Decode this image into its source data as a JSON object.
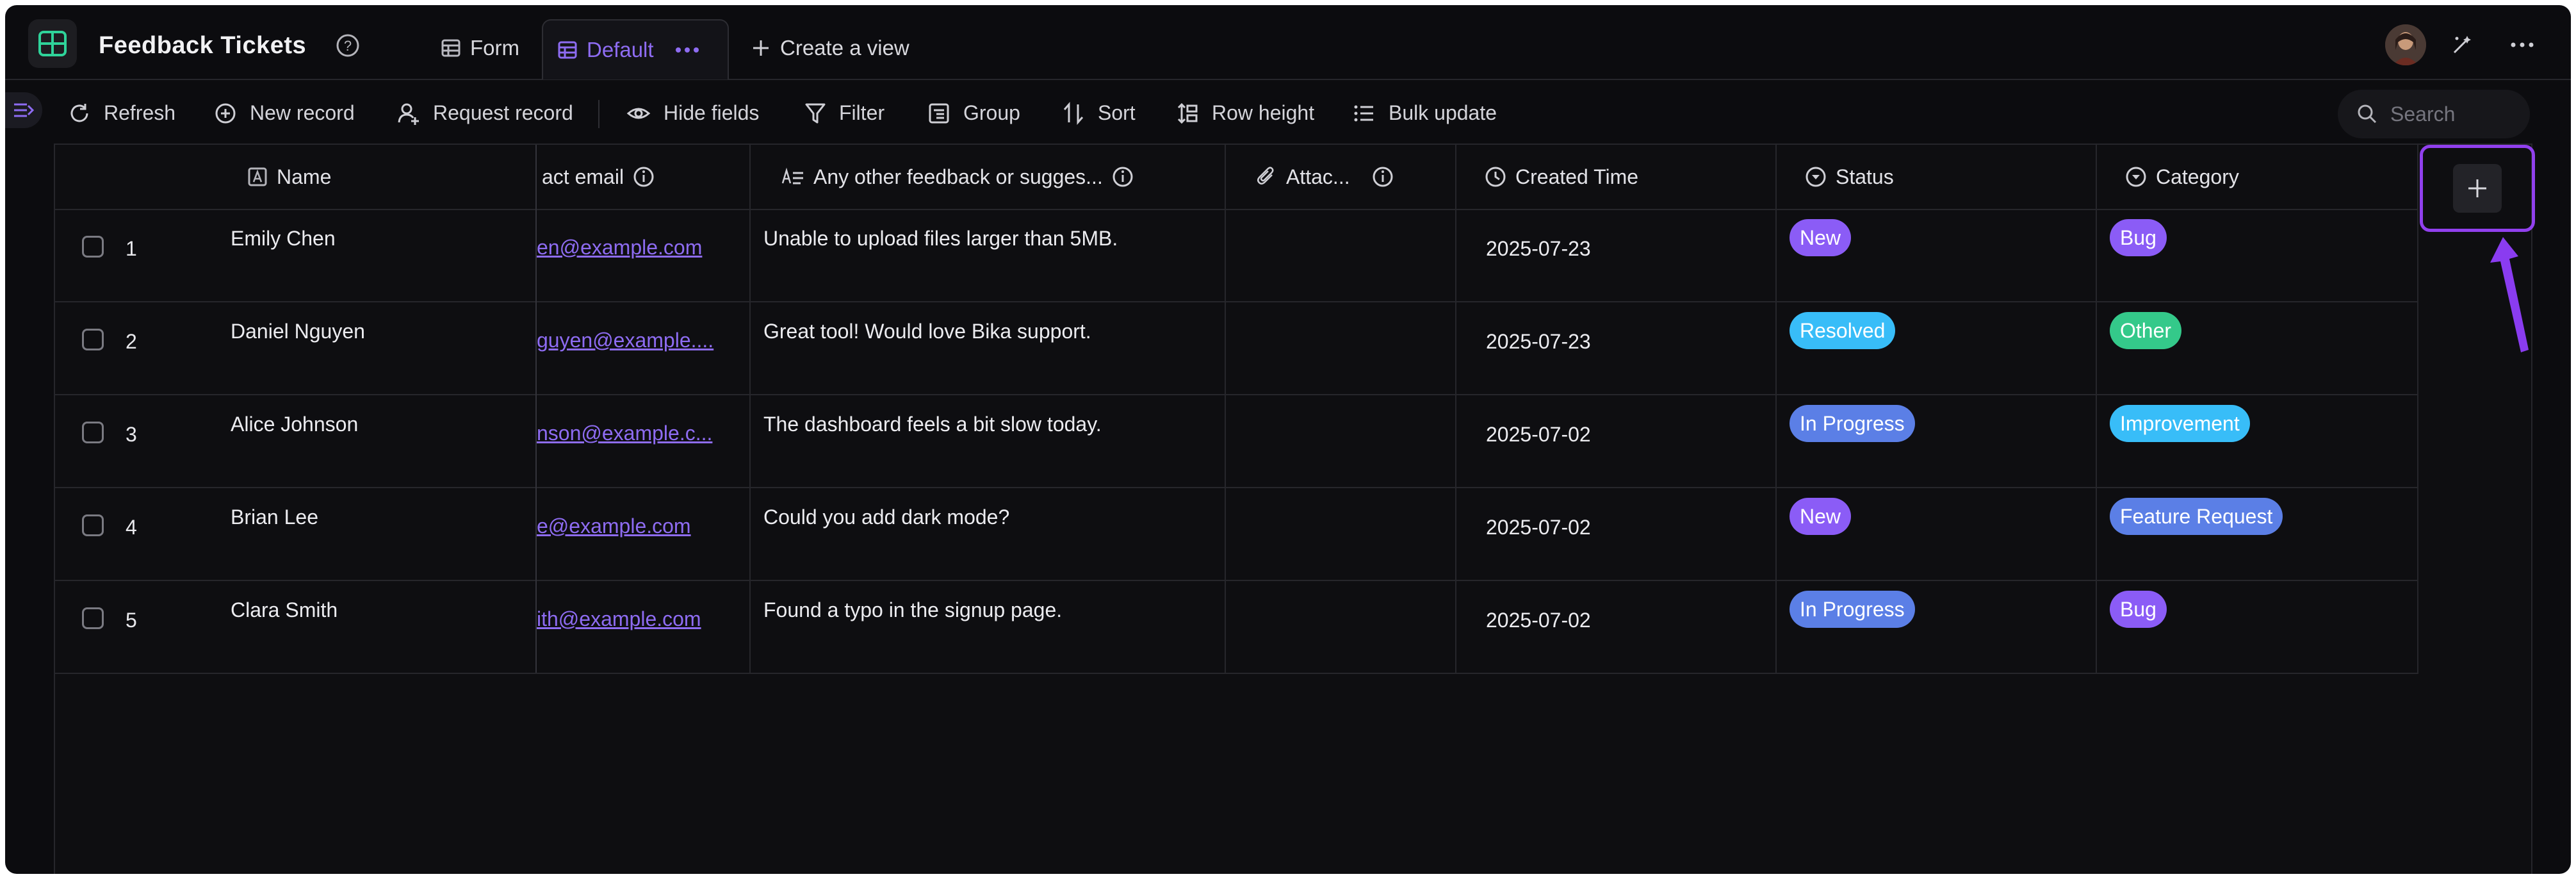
{
  "header": {
    "title": "Feedback Tickets",
    "tabs": [
      {
        "label": "Form",
        "icon": "table-icon"
      },
      {
        "label": "Default",
        "icon": "grid-view-icon",
        "active": true
      },
      {
        "label": "Create a view",
        "icon": "plus-icon"
      }
    ]
  },
  "toolbar": {
    "refresh": "Refresh",
    "new_record": "New record",
    "request_record": "Request record",
    "hide_fields": "Hide fields",
    "filter": "Filter",
    "group": "Group",
    "sort": "Sort",
    "row_height": "Row height",
    "bulk_update": "Bulk update",
    "search_placeholder": "Search"
  },
  "columns": {
    "name": "Name",
    "email": "act email",
    "feedback": "Any other feedback or sugges...",
    "attachment": "Attac...",
    "created": "Created Time",
    "status": "Status",
    "category": "Category"
  },
  "rows": [
    {
      "num": "1",
      "name": "Emily Chen",
      "email": "en@example.com",
      "feedback": "Unable to upload files larger than 5MB.",
      "created": "2025-07-23",
      "status": "New",
      "category": "Bug"
    },
    {
      "num": "2",
      "name": "Daniel Nguyen",
      "email": "guyen@example....",
      "feedback": "Great tool! Would love Bika support.",
      "created": "2025-07-23",
      "status": "Resolved",
      "category": "Other"
    },
    {
      "num": "3",
      "name": "Alice Johnson",
      "email": "nson@example.c...",
      "feedback": "The dashboard feels a bit slow today.",
      "created": "2025-07-02",
      "status": "In Progress",
      "category": "Improvement"
    },
    {
      "num": "4",
      "name": "Brian Lee",
      "email": "e@example.com",
      "feedback": "Could you add dark mode?",
      "created": "2025-07-02",
      "status": "New",
      "category": "Feature Request"
    },
    {
      "num": "5",
      "name": "Clara Smith",
      "email": "ith@example.com",
      "feedback": "Found a typo in the signup page.",
      "created": "2025-07-02",
      "status": "In Progress",
      "category": "Bug"
    }
  ],
  "colors": {
    "accent": "#8e6cf2",
    "highlight": "#9140ee",
    "new": "#8b5cf6",
    "resolved": "#38bdf8",
    "in_progress": "#5b7fe6",
    "bug": "#8b5cf6",
    "other": "#34c98a",
    "improvement": "#38bdf8",
    "feature_request": "#5b7fe6"
  }
}
